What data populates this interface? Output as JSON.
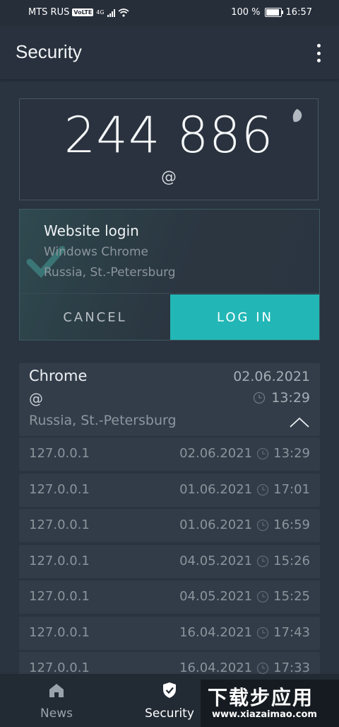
{
  "status_bar": {
    "carrier": "MTS RUS",
    "volte": "VoLTE",
    "network": "4G",
    "battery": "100 %",
    "time": "16:57"
  },
  "app_bar": {
    "title": "Security",
    "menu_icon": "more-vert-icon"
  },
  "code_card": {
    "code": "244 886",
    "account": "@",
    "timer_icon": "countdown-pie-icon"
  },
  "login_request": {
    "title": "Website login",
    "client": "Windows Chrome",
    "location": "Russia, St.-Petersburg",
    "cancel_label": "CANCEL",
    "login_label": "LOG IN"
  },
  "session": {
    "browser": "Chrome",
    "date": "02.06.2021",
    "account": "@",
    "time": "13:29",
    "location": "Russia, St.-Petersburg",
    "history": [
      {
        "ip": "127.0.0.1",
        "date": "02.06.2021",
        "time": "13:29"
      },
      {
        "ip": "127.0.0.1",
        "date": "01.06.2021",
        "time": "17:01"
      },
      {
        "ip": "127.0.0.1",
        "date": "01.06.2021",
        "time": "16:59"
      },
      {
        "ip": "127.0.0.1",
        "date": "04.05.2021",
        "time": "15:26"
      },
      {
        "ip": "127.0.0.1",
        "date": "04.05.2021",
        "time": "15:25"
      },
      {
        "ip": "127.0.0.1",
        "date": "16.04.2021",
        "time": "17:43"
      },
      {
        "ip": "127.0.0.1",
        "date": "16.04.2021",
        "time": "17:33"
      }
    ]
  },
  "bottom_nav": {
    "items": [
      {
        "label": "News",
        "icon": "home-icon"
      },
      {
        "label": "Security",
        "icon": "shield-check-icon",
        "active": true
      }
    ]
  },
  "watermark": {
    "text": "下载步应用",
    "url": "www.xiazaimao.com"
  },
  "colors": {
    "background": "#2a3340",
    "accent": "#22b7b6",
    "card": "#323c48"
  }
}
